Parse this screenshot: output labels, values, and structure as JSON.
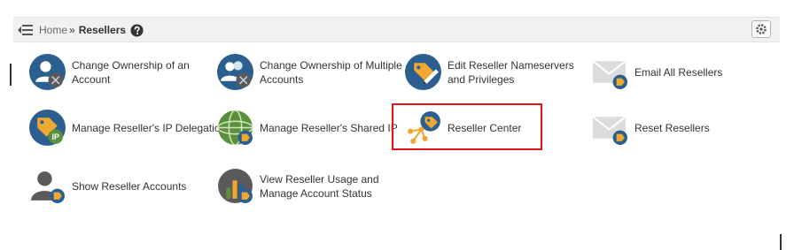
{
  "breadcrumb": {
    "home": "Home",
    "separator": "»",
    "current": "Resellers"
  },
  "colors": {
    "highlight": "#e0161b",
    "icon_blue": "#2a5f8f",
    "icon_orange": "#f0a830"
  },
  "tiles": [
    {
      "label": "Change Ownership of an Account",
      "icon": "user-badge-icon"
    },
    {
      "label": "Change Ownership of Multiple Accounts",
      "icon": "users-badge-icon"
    },
    {
      "label": "Edit Reseller Nameservers and Privileges",
      "icon": "tag-pencil-icon"
    },
    {
      "label": "Email All Resellers",
      "icon": "envelope-icon"
    },
    {
      "label": "Manage Reseller's IP Delegation",
      "icon": "ip-tag-icon"
    },
    {
      "label": "Manage Reseller's Shared IP",
      "icon": "globe-icon"
    },
    {
      "label": "Reseller Center",
      "icon": "network-tag-icon"
    },
    {
      "label": "Reset Resellers",
      "icon": "envelope-icon"
    },
    {
      "label": "Show Reseller Accounts",
      "icon": "user-silhouette-icon"
    },
    {
      "label": "View Reseller Usage and Manage Account Status",
      "icon": "bar-chart-icon"
    }
  ]
}
